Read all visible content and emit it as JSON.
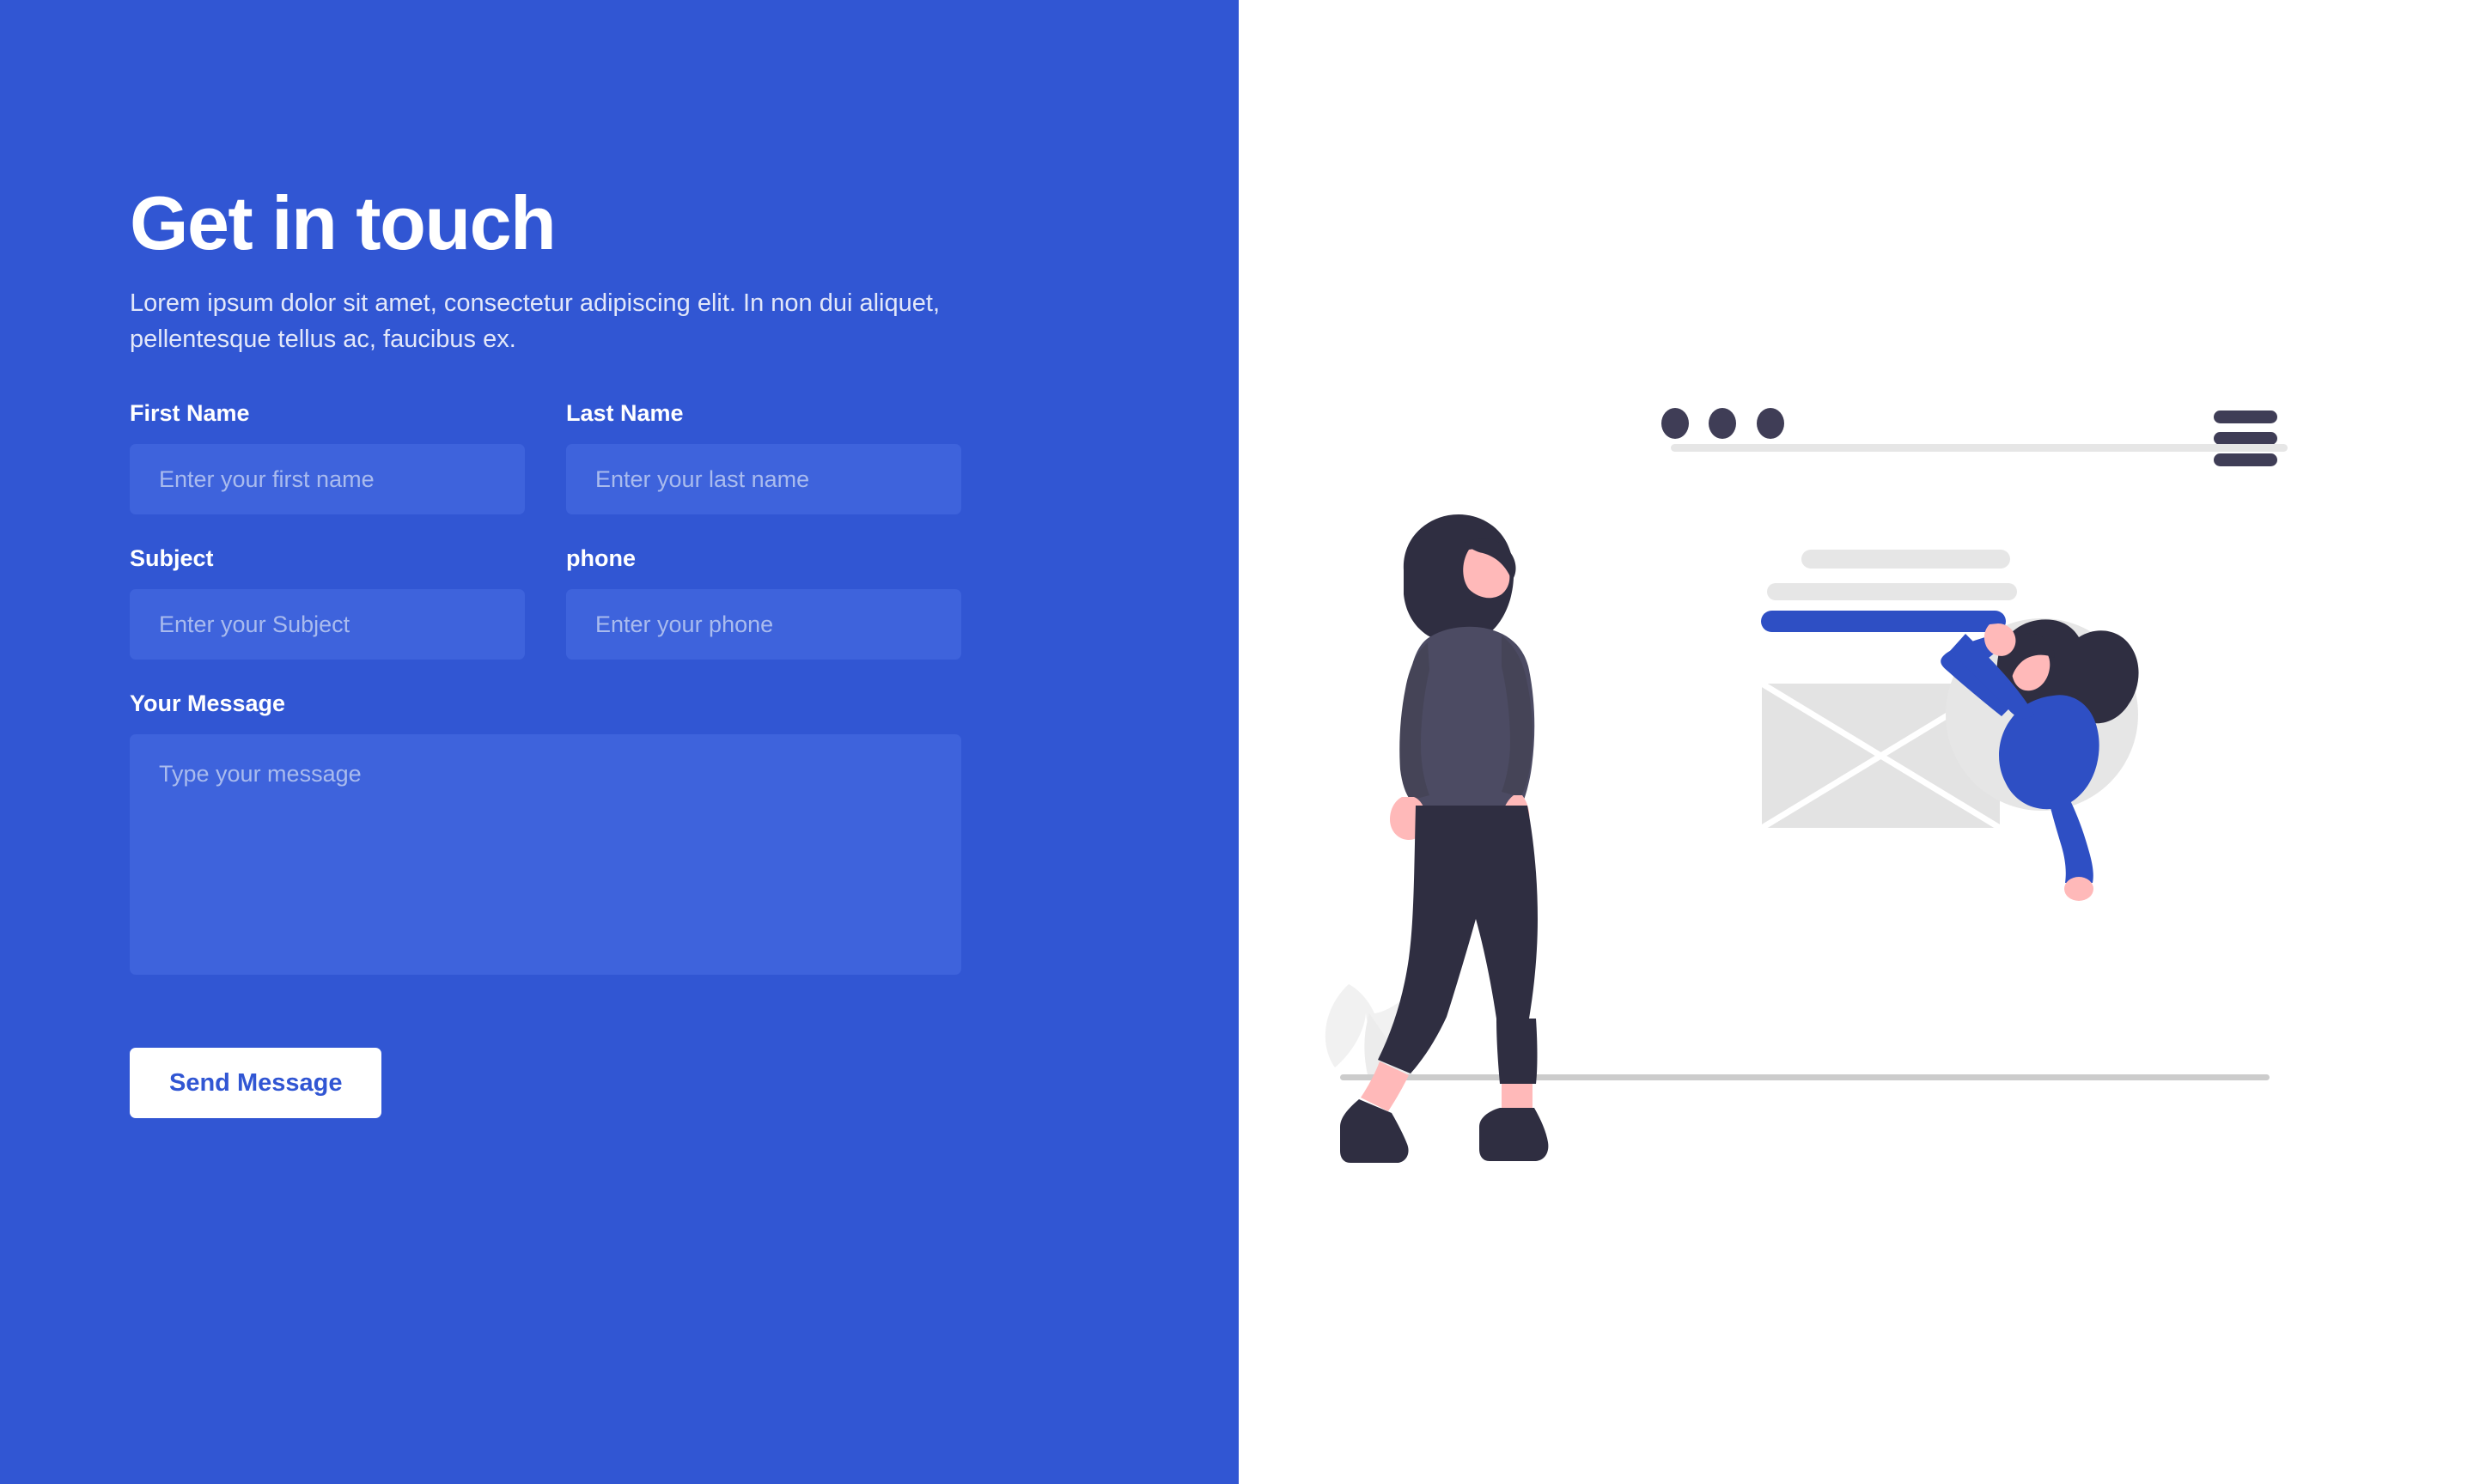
{
  "theme": {
    "panel_blue": "#3156D3",
    "input_blue": "#3E63DC",
    "placeholder": "#A9BBEE",
    "button_bg": "#FFFFFF",
    "button_text": "#3156D3",
    "illustration_blue": "#2E4FC4",
    "illustration_dark": "#2F2E41",
    "illustration_navy": "#3F3D56",
    "illustration_skin": "#FFB9B9",
    "illustration_gray": "#E6E6E6"
  },
  "header": {
    "title": "Get in touch",
    "subtitle": "Lorem ipsum dolor sit amet, consectetur adipiscing elit. In non dui aliquet, pellentesque tellus ac, faucibus ex."
  },
  "form": {
    "fields": [
      {
        "label": "First Name",
        "placeholder": "Enter your first name",
        "value": "",
        "name": "first-name"
      },
      {
        "label": "Last Name",
        "placeholder": "Enter your last name",
        "value": "",
        "name": "last-name"
      },
      {
        "label": "Subject",
        "placeholder": "Enter your Subject",
        "value": "",
        "name": "subject"
      },
      {
        "label": "phone",
        "placeholder": "Enter your phone",
        "value": "",
        "name": "phone"
      }
    ],
    "message": {
      "label": "Your Message",
      "placeholder": "Type your message",
      "value": ""
    },
    "submit_label": "Send Message"
  },
  "illustration": {
    "browser_mock": {
      "dots_count": 3,
      "menu_icon": "hamburger-icon",
      "content_bars": [
        {
          "color": "#E6E6E6",
          "kind": "gray-bar-short"
        },
        {
          "color": "#E6E6E6",
          "kind": "gray-bar-long"
        },
        {
          "color": "#2E4FC4",
          "kind": "blue-bar"
        }
      ],
      "image_placeholder": "crossed-rectangle"
    },
    "characters": [
      {
        "name": "walking-woman",
        "hair": "#2F2E41",
        "top": "#4C4B63",
        "trousers": "#2F2E41",
        "skin": "#FFB9B9",
        "boots": "#2F2E41"
      },
      {
        "name": "reaching-woman",
        "hair": "#2F2E41",
        "top": "#2E4FC4",
        "skin": "#FFB9B9",
        "backdrop": "#E6E6E6"
      }
    ],
    "ground_line_color": "#CCCCCC",
    "plant_color": "#F2F2F2"
  }
}
